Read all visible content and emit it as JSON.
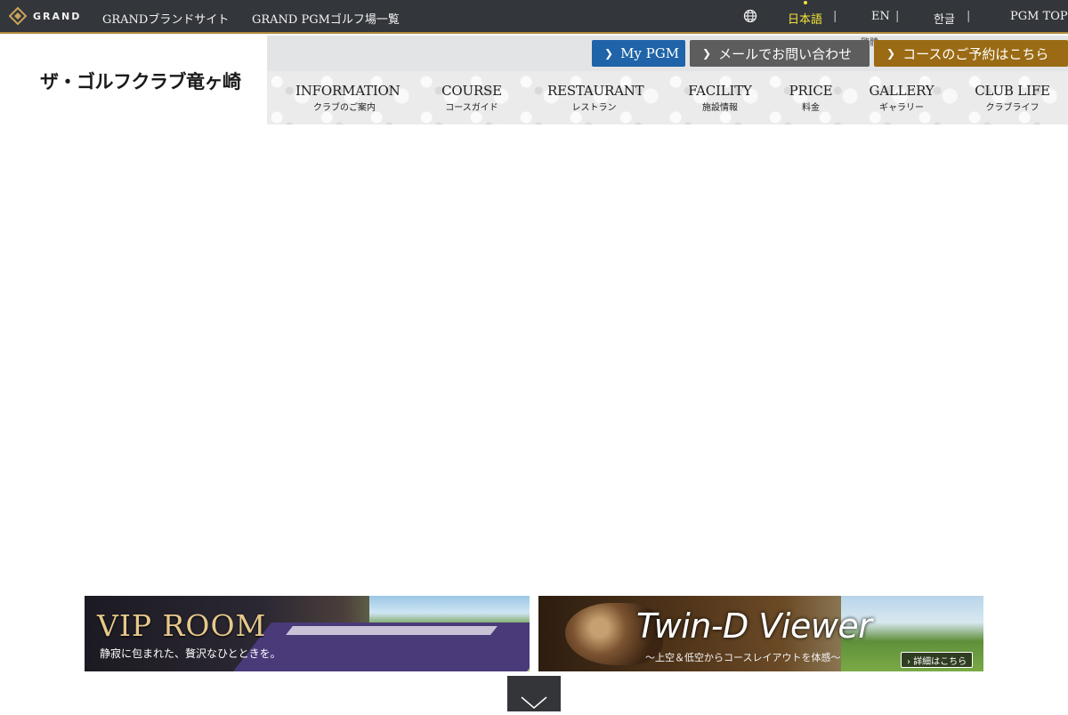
{
  "topbar": {
    "brand_text": "GRAND",
    "brand_site_link": "GRANDブランドサイト",
    "course_list_link": "GRAND PGMゴルフ場一覧",
    "globe_icon": "globe-icon",
    "languages": [
      "日本語",
      "EN",
      "한글"
    ],
    "active_language": "日本語",
    "separator": "|",
    "pgm_top_link": "PGM TOP"
  },
  "header": {
    "logo_text": "ザ・ゴルフクラブ竜ヶ崎",
    "mini_label": "繁體",
    "buttons": {
      "mypgm": "My PGM",
      "mail": "メールでお問い合わせ",
      "reserve": "コースのご予約はこちら"
    },
    "button_colors": {
      "mypgm": "#1f63a8",
      "mail": "#5d5d5d",
      "reserve": "#9a6b14"
    }
  },
  "nav": {
    "items": [
      {
        "en": "INFORMATION",
        "ja": "クラブのご案内"
      },
      {
        "en": "COURSE",
        "ja": "コースガイド"
      },
      {
        "en": "RESTAURANT",
        "ja": "レストラン"
      },
      {
        "en": "FACILITY",
        "ja": "施設情報"
      },
      {
        "en": "PRICE",
        "ja": "料金"
      },
      {
        "en": "GALLERY",
        "ja": "ギャラリー"
      },
      {
        "en": "CLUB LIFE",
        "ja": "クラブライフ"
      }
    ]
  },
  "banners": {
    "vip": {
      "title": "VIP ROOM",
      "subtitle": "静寂に包まれた、贅沢なひとときを。"
    },
    "twin": {
      "title": "Twin-D Viewer",
      "subtitle": "〜上空＆低空からコースレイアウトを体感〜",
      "detail_button": "詳細はこちら"
    }
  },
  "scroll_icon": "chevron-down-icon",
  "colors": {
    "topbar_bg": "#33363b",
    "gold_accent": "#b28a3c",
    "active_lang": "#f2e23a"
  }
}
